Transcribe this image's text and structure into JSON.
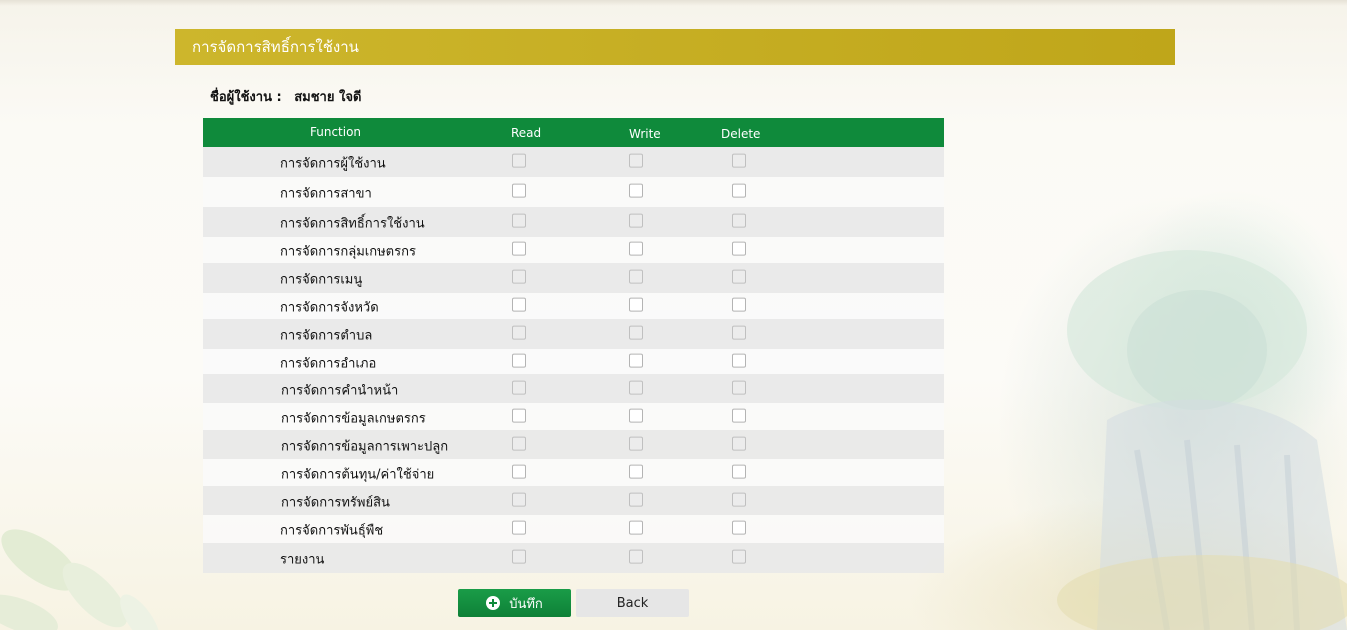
{
  "header": {
    "title": "การจัดการสิทธิ์การใช้งาน"
  },
  "user": {
    "label": "ชื่อผู้ใช้งาน :",
    "name": "สมชาย ใจดี"
  },
  "table": {
    "columns": {
      "function": "Function",
      "read": "Read",
      "write": "Write",
      "delete": "Delete"
    },
    "rows": [
      {
        "name": "การจัดการผู้ใช้งาน",
        "read": false,
        "write": false,
        "delete": false
      },
      {
        "name": "การจัดการสาขา",
        "read": false,
        "write": false,
        "delete": false
      },
      {
        "name": "การจัดการสิทธิ์การใช้งาน",
        "read": false,
        "write": false,
        "delete": false
      },
      {
        "name": "การจัดการกลุ่มเกษตรกร",
        "read": false,
        "write": false,
        "delete": false
      },
      {
        "name": "การจัดการเมนู",
        "read": false,
        "write": false,
        "delete": false
      },
      {
        "name": "การจัดการจังหวัด",
        "read": false,
        "write": false,
        "delete": false
      },
      {
        "name": "การจัดการตำบล",
        "read": false,
        "write": false,
        "delete": false
      },
      {
        "name": "การจัดการอำเภอ",
        "read": false,
        "write": false,
        "delete": false
      },
      {
        "name": "การจัดการคำนำหน้า",
        "read": false,
        "write": false,
        "delete": false
      },
      {
        "name": "การจัดการข้อมูลเกษตรกร",
        "read": false,
        "write": false,
        "delete": false
      },
      {
        "name": "การจัดการข้อมูลการเพาะปลูก",
        "read": false,
        "write": false,
        "delete": false
      },
      {
        "name": "การจัดการต้นทุน/ค่าใช้จ่าย",
        "read": false,
        "write": false,
        "delete": false
      },
      {
        "name": "การจัดการทรัพย์สิน",
        "read": false,
        "write": false,
        "delete": false
      },
      {
        "name": "การจัดการพันธุ์พืช",
        "read": false,
        "write": false,
        "delete": false
      },
      {
        "name": "รายงาน",
        "read": false,
        "write": false,
        "delete": false
      }
    ]
  },
  "actions": {
    "save_label": "บันทึก",
    "back_label": "Back",
    "save_icon": "plus-circle-icon"
  },
  "colors": {
    "header_bar": "#c4ab1f",
    "table_header": "#0f8a3b",
    "save_button": "#14904a",
    "back_button": "#e6e6e6"
  }
}
